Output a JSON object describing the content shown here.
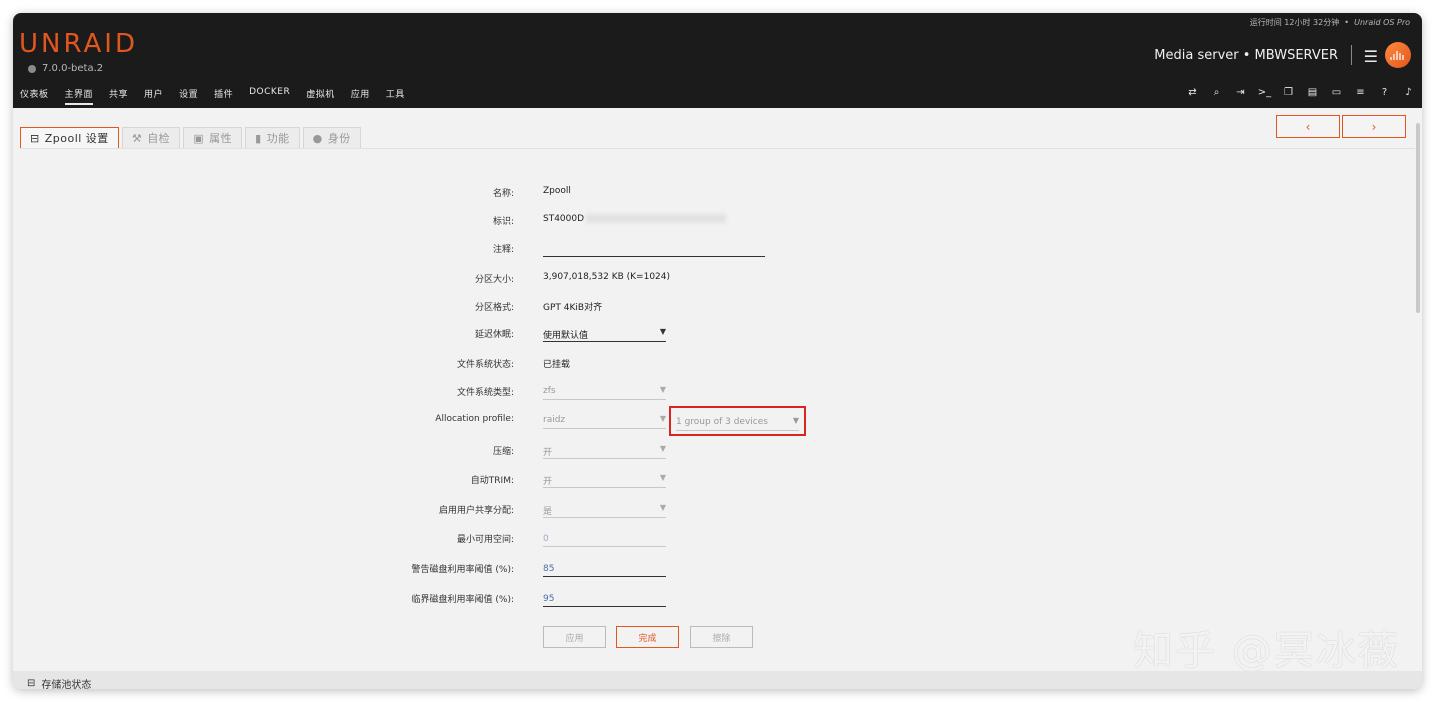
{
  "header": {
    "logo": "UNRAID",
    "version": "7.0.0-beta.2",
    "uptime": "运行时间 12小时 32分钟",
    "separator": "•",
    "edition": "Unraid OS Pro",
    "server_name": "Media server • MBWSERVER"
  },
  "nav": {
    "items": [
      {
        "label": "仪表板",
        "active": false
      },
      {
        "label": "主界面",
        "active": true
      },
      {
        "label": "共享",
        "active": false
      },
      {
        "label": "用户",
        "active": false
      },
      {
        "label": "设置",
        "active": false
      },
      {
        "label": "插件",
        "active": false
      },
      {
        "label": "DOCKER",
        "active": false
      },
      {
        "label": "虚拟机",
        "active": false
      },
      {
        "label": "应用",
        "active": false
      },
      {
        "label": "工具",
        "active": false
      }
    ],
    "tool_icons": [
      "sync-icon",
      "search-icon",
      "logout-icon",
      "terminal-icon",
      "copy-icon",
      "feedback-icon",
      "monitor-icon",
      "log-icon",
      "help-icon",
      "bell-icon"
    ]
  },
  "tabs": [
    {
      "label": "Zpooll 设置",
      "icon": "drive-icon",
      "active": true
    },
    {
      "label": "自检",
      "icon": "wrench-icon",
      "active": false
    },
    {
      "label": "属性",
      "icon": "id-card-icon",
      "active": false
    },
    {
      "label": "功能",
      "icon": "book-icon",
      "active": false
    },
    {
      "label": "身份",
      "icon": "user-icon",
      "active": false
    }
  ],
  "pager": {
    "prev": "‹",
    "next": "›"
  },
  "form": {
    "name_label": "名称:",
    "name_value": "Zpooll",
    "id_label": "标识:",
    "id_value": "ST4000D",
    "comment_label": "注释:",
    "size_label": "分区大小:",
    "size_value": "3,907,018,532 KB (K=1024)",
    "format_label": "分区格式:",
    "format_value": "GPT 4KiB对齐",
    "spindown_label": "延迟休眠:",
    "spindown_value": "使用默认值",
    "fs_status_label": "文件系统状态:",
    "fs_status_value": "已挂载",
    "fs_type_label": "文件系统类型:",
    "fs_type_value": "zfs",
    "alloc_label": "Allocation profile:",
    "alloc_value": "raidz",
    "alloc_group_value": "1 group of 3 devices",
    "compress_label": "压缩:",
    "compress_value": "开",
    "trim_label": "自动TRIM:",
    "trim_value": "开",
    "share_label": "启用用户共享分配:",
    "share_value": "是",
    "min_free_label": "最小可用空间:",
    "min_free_value": "0",
    "warn_label": "警告磁盘利用率阈值 (%):",
    "warn_value": "85",
    "crit_label": "临界磁盘利用率阈值 (%):",
    "crit_value": "95"
  },
  "buttons": {
    "apply": "应用",
    "done": "完成",
    "erase": "擦除"
  },
  "footer": {
    "pool_status": "存储池状态"
  },
  "watermark": "知乎 @冥冰薇",
  "colors": {
    "accent": "#e2561f",
    "highlight": "#dd2222",
    "header_bg": "#1c1b1b"
  }
}
